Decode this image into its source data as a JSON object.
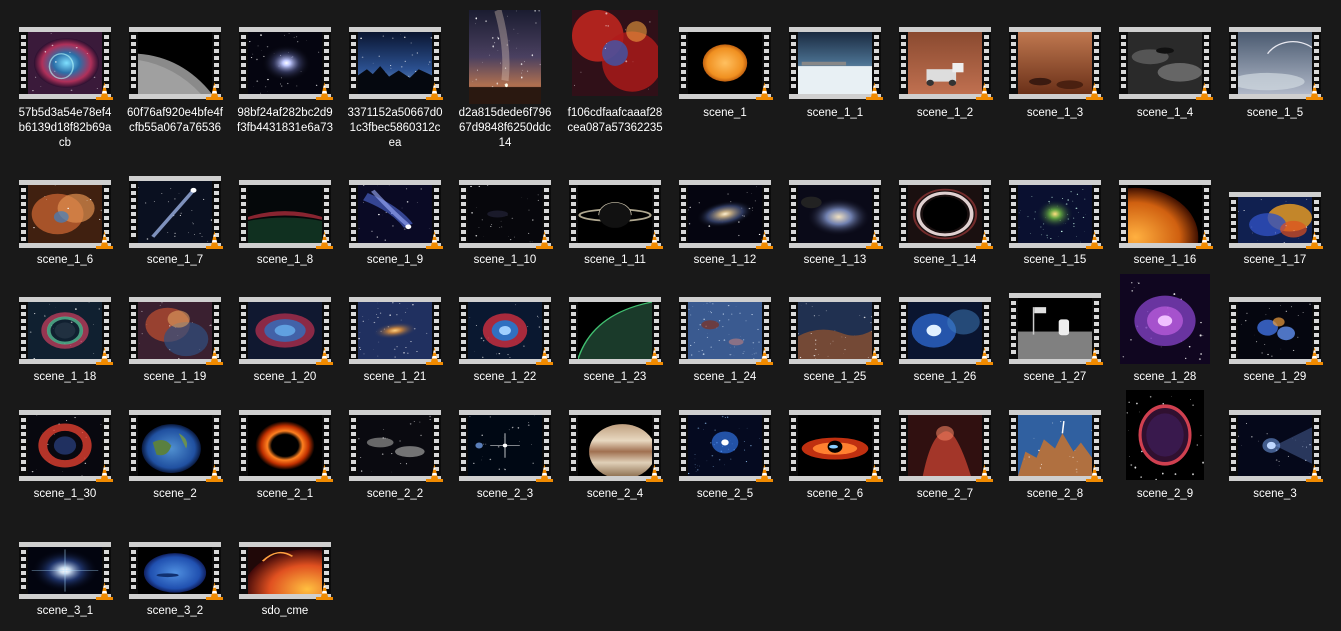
{
  "window": {
    "background": "#191919",
    "label_color": "#ffffff",
    "film_frame_color": "#cfcfcf",
    "cone_color": "#f08a00"
  },
  "icon_overlay": "vlc-cone-icon",
  "items": [
    {
      "name": "57b5d3a54e78ef4b6139d18f82b69acb",
      "kind": "video",
      "art": "nebula-blue"
    },
    {
      "name": "60f76af920e4bfe4fcfb55a067a76536",
      "kind": "video",
      "art": "moon-surface"
    },
    {
      "name": "98bf24af282bc2d9f3fb4431831e6a73",
      "kind": "video",
      "art": "spiral-galaxy"
    },
    {
      "name": "3371152a50667d01c3fbec5860312cea",
      "kind": "video",
      "art": "night-sky-mountains"
    },
    {
      "name": "d2a815dede6f79667d9848f6250ddc14",
      "kind": "photo",
      "art": "milky-way-desert"
    },
    {
      "name": "f106cdfaafcaaaf28cea087a57362235",
      "kind": "photo",
      "art": "red-nebula"
    },
    {
      "name": "scene_1",
      "kind": "video",
      "art": "orange-sun"
    },
    {
      "name": "scene_1_1",
      "kind": "video",
      "art": "earth-limb-satellite"
    },
    {
      "name": "scene_1_2",
      "kind": "video",
      "art": "mars-rover"
    },
    {
      "name": "scene_1_3",
      "kind": "video",
      "art": "mars-rocks"
    },
    {
      "name": "scene_1_4",
      "kind": "video",
      "art": "moon-craters"
    },
    {
      "name": "scene_1_5",
      "kind": "video",
      "art": "planet-clouds"
    },
    {
      "name": "scene_1_6",
      "kind": "video",
      "art": "orange-nebula"
    },
    {
      "name": "scene_1_7",
      "kind": "video",
      "art": "comet-streak"
    },
    {
      "name": "scene_1_8",
      "kind": "video",
      "art": "aurora-horizon"
    },
    {
      "name": "scene_1_9",
      "kind": "video",
      "art": "blue-comet"
    },
    {
      "name": "scene_1_10",
      "kind": "video",
      "art": "dark-space"
    },
    {
      "name": "scene_1_11",
      "kind": "video",
      "art": "saturn"
    },
    {
      "name": "scene_1_12",
      "kind": "video",
      "art": "barred-galaxy"
    },
    {
      "name": "scene_1_13",
      "kind": "video",
      "art": "galaxy-asteroid"
    },
    {
      "name": "scene_1_14",
      "kind": "video",
      "art": "black-hole-ring"
    },
    {
      "name": "scene_1_15",
      "kind": "video",
      "art": "star-cluster"
    },
    {
      "name": "scene_1_16",
      "kind": "video",
      "art": "orange-planet-limb"
    },
    {
      "name": "scene_1_17",
      "kind": "video",
      "art": "colorful-nebula"
    },
    {
      "name": "scene_1_18",
      "kind": "video",
      "art": "ring-nebula-green"
    },
    {
      "name": "scene_1_19",
      "kind": "video",
      "art": "dusty-nebula"
    },
    {
      "name": "scene_1_20",
      "kind": "video",
      "art": "helix-eye"
    },
    {
      "name": "scene_1_21",
      "kind": "video",
      "art": "galaxy-field"
    },
    {
      "name": "scene_1_22",
      "kind": "video",
      "art": "helix-red"
    },
    {
      "name": "scene_1_23",
      "kind": "video",
      "art": "earth-night-limb"
    },
    {
      "name": "scene_1_24",
      "kind": "video",
      "art": "blue-starfield"
    },
    {
      "name": "scene_1_25",
      "kind": "video",
      "art": "carina-nebula"
    },
    {
      "name": "scene_1_26",
      "kind": "video",
      "art": "blue-reflection"
    },
    {
      "name": "scene_1_27",
      "kind": "video",
      "art": "moon-astronaut"
    },
    {
      "name": "scene_1_28",
      "kind": "photo",
      "art": "crab-nebula"
    },
    {
      "name": "scene_1_29",
      "kind": "video",
      "art": "blue-cluster"
    },
    {
      "name": "scene_1_30",
      "kind": "video",
      "art": "red-ring-nebula"
    },
    {
      "name": "scene_2",
      "kind": "video",
      "art": "earth-globe"
    },
    {
      "name": "scene_2_1",
      "kind": "video",
      "art": "black-hole-orange"
    },
    {
      "name": "scene_2_2",
      "kind": "video",
      "art": "interacting-galaxies"
    },
    {
      "name": "scene_2_3",
      "kind": "video",
      "art": "bright-star"
    },
    {
      "name": "scene_2_4",
      "kind": "video",
      "art": "jupiter"
    },
    {
      "name": "scene_2_5",
      "kind": "video",
      "art": "blue-star-burst"
    },
    {
      "name": "scene_2_6",
      "kind": "video",
      "art": "accretion-disk"
    },
    {
      "name": "scene_2_7",
      "kind": "video",
      "art": "pillar-nebula"
    },
    {
      "name": "scene_2_8",
      "kind": "video",
      "art": "mystic-mountain"
    },
    {
      "name": "scene_2_9",
      "kind": "photo",
      "art": "supernova-remnant"
    },
    {
      "name": "scene_3",
      "kind": "video",
      "art": "blue-comet-head"
    },
    {
      "name": "scene_3_1",
      "kind": "video",
      "art": "pulsar-glow"
    },
    {
      "name": "scene_3_2",
      "kind": "video",
      "art": "neptune"
    },
    {
      "name": "sdo_cme",
      "kind": "video",
      "art": "solar-cme"
    }
  ]
}
